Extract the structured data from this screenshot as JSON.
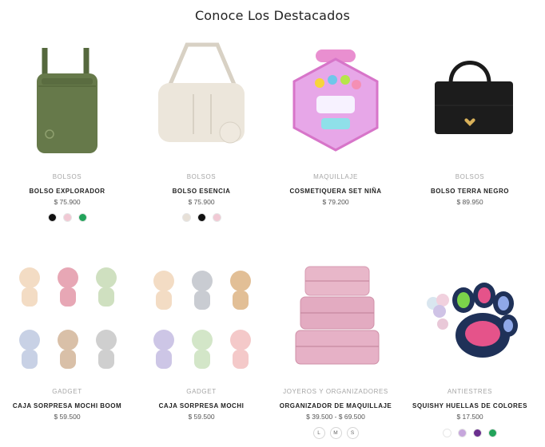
{
  "section": {
    "title": "Conoce Los Destacados"
  },
  "products": [
    {
      "category": "BOLSOS",
      "name": "BOLSO EXPLORADOR",
      "price": "$ 75.900",
      "image": "olive-crossbody-bag",
      "swatches": [
        {
          "color": "#111111"
        },
        {
          "color": "#f1c9d4"
        },
        {
          "color": "#22a35a"
        }
      ]
    },
    {
      "category": "BOLSOS",
      "name": "BOLSO ESENCIA",
      "price": "$ 75.900",
      "image": "cream-shoulder-bag",
      "swatches": [
        {
          "color": "#e7e0d7"
        },
        {
          "color": "#111111"
        },
        {
          "color": "#f1c9d4"
        }
      ]
    },
    {
      "category": "MAQUILLAJE",
      "name": "COSMETIQUERA SET NIÑA",
      "price": "$ 79.200",
      "image": "pink-makeup-case"
    },
    {
      "category": "BOLSOS",
      "name": "BOLSO TERRA NEGRO",
      "price": "$ 89.950",
      "image": "black-handbag"
    },
    {
      "category": "GADGET",
      "name": "CAJA SORPRESA MOCHI BOOM",
      "price": "$ 59.500",
      "image": "mochi-keychains-grid"
    },
    {
      "category": "GADGET",
      "name": "CAJA SORPRESA MOCHI",
      "price": "$ 59.500",
      "image": "mochi-keychains-grid"
    },
    {
      "category": "JOYEROS Y ORGANIZADORES",
      "name": "ORGANIZADOR DE MAQUILLAJE",
      "price": "$ 39.500 - $ 69.500",
      "image": "pink-suitcase-stack",
      "sizes": [
        "L",
        "M",
        "S"
      ]
    },
    {
      "category": "ANTIESTRES",
      "name": "SQUISHY HUELLAS DE COLORES",
      "price": "$ 17.500",
      "image": "paw-squishy",
      "swatches": [
        {
          "color": "#ffffff"
        },
        {
          "color": "#c6a6dc"
        },
        {
          "color": "#6a2f8e"
        },
        {
          "color": "#22a35a"
        }
      ]
    }
  ]
}
